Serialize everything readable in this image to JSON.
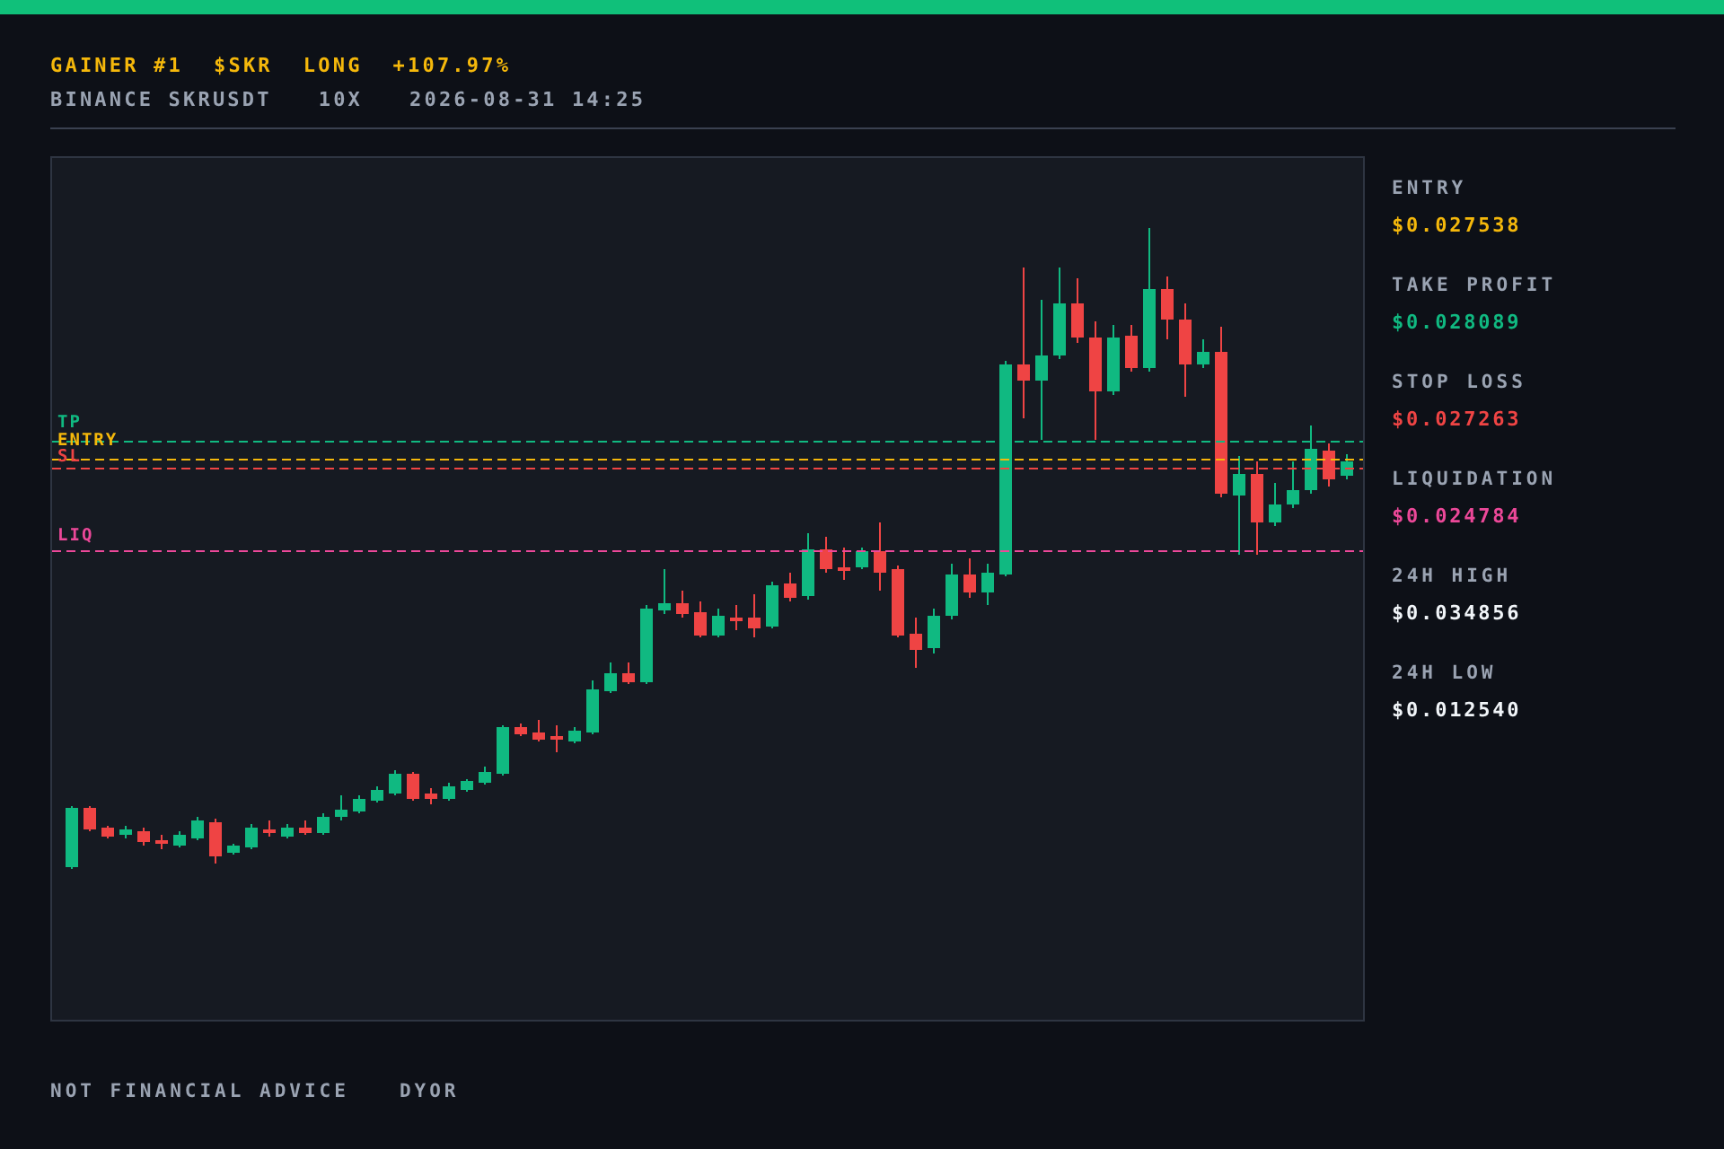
{
  "header": {
    "title": [
      "GAINER #1",
      "$SKR",
      "LONG",
      "+107.97%"
    ],
    "subtitle": [
      "BINANCE SKRUSDT",
      "10X",
      "2026-08-31 14:25"
    ]
  },
  "chart": {
    "levels": [
      {
        "label": "TP",
        "color": "#10b981"
      },
      {
        "label": "ENTRY",
        "color": "#f5b80b"
      },
      {
        "label": "SL",
        "color": "#ef4444"
      },
      {
        "label": "LIQ",
        "color": "#ec4899"
      }
    ]
  },
  "stats": [
    {
      "label": "ENTRY",
      "value": "$0.027538",
      "color": "#f5b80b"
    },
    {
      "label": "TAKE PROFIT",
      "value": "$0.028089",
      "color": "#10b981"
    },
    {
      "label": "STOP LOSS",
      "value": "$0.027263",
      "color": "#ef4444"
    },
    {
      "label": "LIQUIDATION",
      "value": "$0.024784",
      "color": "#ec4899"
    },
    {
      "label": "24H HIGH",
      "value": "$0.034856",
      "color": "#f1f5f9"
    },
    {
      "label": "24H LOW",
      "value": "$0.012540",
      "color": "#f1f5f9"
    }
  ],
  "footer": [
    "NOT FINANCIAL ADVICE",
    "DYOR"
  ]
}
